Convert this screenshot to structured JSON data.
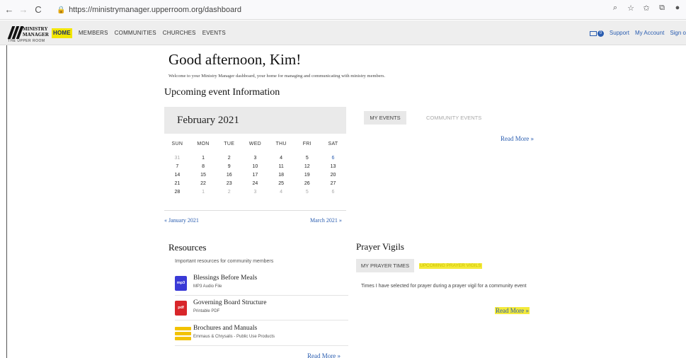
{
  "browser": {
    "url": "https://ministrymanager.upperroom.org/dashboard",
    "back_icon": "←",
    "forward_icon": "→",
    "reload_icon": "C",
    "lock_icon": "🔒",
    "zoom_icon": "⌕",
    "bookmark_icon": "☆",
    "favorites_icon": "✩",
    "collections_icon": "⧉",
    "profile_icon": "●"
  },
  "header": {
    "logo_line1": "MINISTRY",
    "logo_line2": "MANAGER",
    "logo_sub": "THE UPPER ROOM",
    "nav": [
      "HOME",
      "MEMBERS",
      "COMMUNITIES",
      "CHURCHES",
      "EVENTS"
    ],
    "mail_count": "0",
    "support": "Support",
    "account": "My Account",
    "signout": "Sign o"
  },
  "main": {
    "greeting": "Good afternoon, Kim!",
    "welcome": "Welcome to your Ministry Manager dashboard, your home for managing and communicating with ministry members.",
    "upcoming_title": "Upcoming event Information"
  },
  "calendar": {
    "month": "February 2021",
    "dow": [
      "SUN",
      "MON",
      "TUE",
      "WED",
      "THU",
      "FRI",
      "SAT"
    ],
    "weeks": [
      [
        "31",
        "1",
        "2",
        "3",
        "4",
        "5",
        "6"
      ],
      [
        "7",
        "8",
        "9",
        "10",
        "11",
        "12",
        "13"
      ],
      [
        "14",
        "15",
        "16",
        "17",
        "18",
        "19",
        "20"
      ],
      [
        "21",
        "22",
        "23",
        "24",
        "25",
        "26",
        "27"
      ],
      [
        "28",
        "1",
        "2",
        "3",
        "4",
        "5",
        "6"
      ]
    ],
    "prev": "« January 2021",
    "next": "March 2021 »"
  },
  "events": {
    "tab_my": "MY EVENTS",
    "tab_community": "COMMUNITY EVENTS",
    "read_more": "Read More »"
  },
  "resources": {
    "title": "Resources",
    "description": "Important resources for community members",
    "items": [
      {
        "name": "Blessings Before Meals",
        "type": "MP3 Audio File",
        "icon": "mp3",
        "color": "#3a3ad6"
      },
      {
        "name": "Governing Board Structure",
        "type": "Printable PDF",
        "icon": "pdf",
        "color": "#d8262a"
      },
      {
        "name": "Brochures and Manuals",
        "type": "Emmaus & Chrysalis - Public Use Products",
        "icon": "",
        "color": "#f2c200"
      }
    ],
    "read_more": "Read More »"
  },
  "prayer": {
    "title": "Prayer Vigils",
    "tab_my": "MY PRAYER TIMES",
    "tab_upcoming": "UPCOMING PRAYER VIGILS",
    "description": "Times I have selected for prayer during a prayer vigil for a community event",
    "read_more": "Read More »"
  }
}
